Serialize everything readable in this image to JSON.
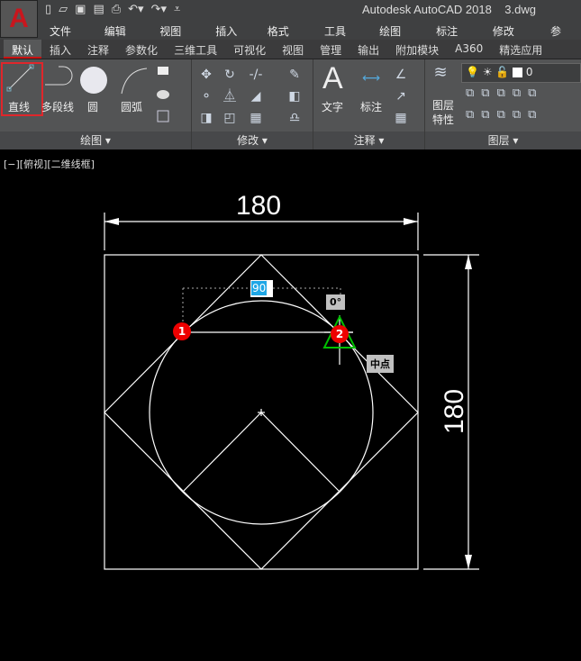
{
  "app": {
    "logo": "A",
    "title": "Autodesk AutoCAD 2018    3.dwg"
  },
  "quick_access": [
    "new-icon",
    "open-icon",
    "save-icon",
    "saveas-icon",
    "print-icon",
    "undo-icon",
    "redo-icon",
    "customize-icon"
  ],
  "menu": [
    "文件(F)",
    "编辑(E)",
    "视图(V)",
    "插入(I)",
    "格式(O)",
    "工具(T)",
    "绘图(D)",
    "标注(N)",
    "修改(M)",
    "参"
  ],
  "tabs": [
    "默认",
    "插入",
    "注释",
    "参数化",
    "三维工具",
    "可视化",
    "视图",
    "管理",
    "输出",
    "附加模块",
    "A360",
    "精选应用"
  ],
  "panels": {
    "draw": {
      "label": "绘图",
      "line": "直线",
      "polyline": "多段线",
      "circle": "圆",
      "arc": "圆弧"
    },
    "modify": {
      "label": "修改"
    },
    "annotation": {
      "label": "注释",
      "text": "文字",
      "dimension": "标注"
    },
    "layers": {
      "label": "图层",
      "props": "图层\n特性",
      "props1": "图层",
      "props2": "特性",
      "current_layer": "0"
    }
  },
  "viewport": {
    "label": "[−][俯视][二维线框]"
  },
  "drawing": {
    "dim_horizontal": "180",
    "dim_vertical": "180",
    "input_value": "90",
    "angle_tip": "0°",
    "snap_tip": "中点",
    "badge1": "1",
    "badge2": "2"
  },
  "colors": {
    "highlight": "#e0262b",
    "snap": "#00c000",
    "input": "#1fa7e6"
  }
}
